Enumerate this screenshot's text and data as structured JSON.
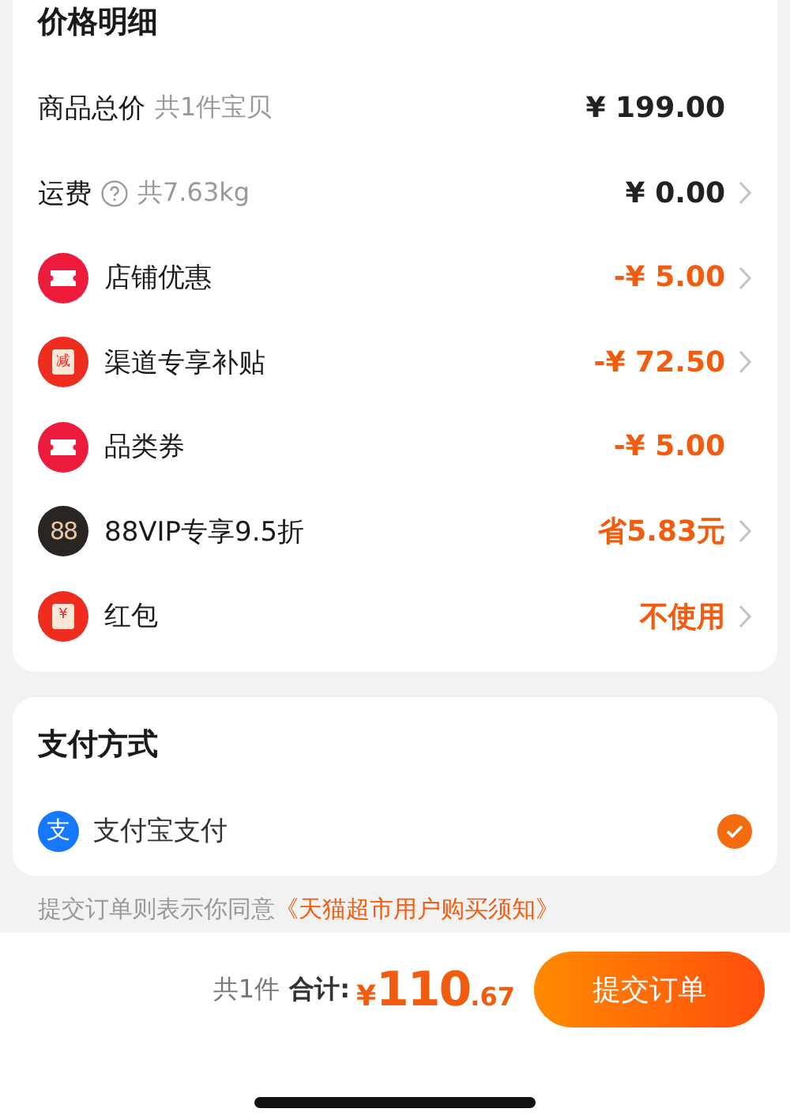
{
  "price_detail": {
    "title": "价格明细",
    "rows": [
      {
        "label": "商品总价",
        "note": "共1件宝贝",
        "help": false,
        "value": "¥ 199.00",
        "highlight": false,
        "arrow": false
      },
      {
        "label": "运费",
        "note": "共7.63kg",
        "help": true,
        "value": "¥ 0.00",
        "highlight": false,
        "arrow": true
      },
      {
        "kind": "ticket",
        "label": "店铺优惠",
        "value": "-¥ 5.00",
        "highlight": true,
        "arrow": true
      },
      {
        "kind": "subsidy",
        "badge": "减",
        "label": "渠道专享补贴",
        "value": "-¥ 72.50",
        "highlight": true,
        "arrow": true
      },
      {
        "kind": "ticket",
        "label": "品类券",
        "value": "-¥ 5.00",
        "highlight": true,
        "arrow": false
      },
      {
        "kind": "vip",
        "badge": "88",
        "label": "88VIP专享9.5折",
        "value": "省5.83元",
        "highlight": true,
        "arrow": true
      },
      {
        "kind": "redpacket",
        "badge": "¥",
        "label": "红包",
        "value": "不使用",
        "highlight": true,
        "arrow": true
      }
    ]
  },
  "payment": {
    "title": "支付方式",
    "methods": [
      {
        "badge": "支",
        "label": "支付宝支付",
        "selected": true
      }
    ]
  },
  "notice": {
    "text": "提交订单则表示你同意",
    "link": "《天猫超市用户购买须知》"
  },
  "footer": {
    "count": "共1件",
    "total_label": "合计:",
    "currency": "¥",
    "integer": "110",
    "decimal": ".67",
    "submit": "提交订单"
  }
}
